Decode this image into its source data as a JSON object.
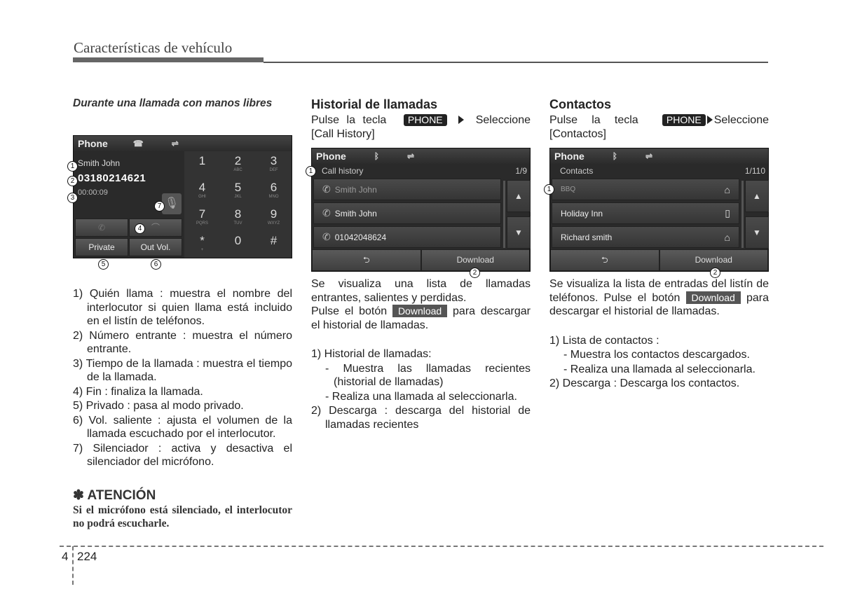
{
  "header": {
    "title": "Características de vehículo"
  },
  "col1": {
    "subtitle": "Durante una llamada con manos libres",
    "screen": {
      "app_title": "Phone",
      "status_icons": [
        "phone-handset-icon",
        "usb-icon"
      ],
      "caller_name": "Smith John",
      "caller_number": "03180214621",
      "call_time": "00:00:09",
      "buttons": {
        "answer": "",
        "end": "",
        "private": "Private",
        "out_vol": "Out Vol."
      },
      "keypad": [
        {
          "digit": "1",
          "letters": ""
        },
        {
          "digit": "2",
          "letters": "ABC"
        },
        {
          "digit": "3",
          "letters": "DEF"
        },
        {
          "digit": "4",
          "letters": "GHI"
        },
        {
          "digit": "5",
          "letters": "JKL"
        },
        {
          "digit": "6",
          "letters": "MNO"
        },
        {
          "digit": "7",
          "letters": "PQRS"
        },
        {
          "digit": "8",
          "letters": "TUV"
        },
        {
          "digit": "9",
          "letters": "WXYZ"
        },
        {
          "digit": "*",
          "letters": "+"
        },
        {
          "digit": "0",
          "letters": ""
        },
        {
          "digit": "#",
          "letters": ""
        }
      ],
      "callouts": [
        "1",
        "2",
        "3",
        "4",
        "5",
        "6",
        "7"
      ]
    },
    "items": [
      "1) Quién llama : muestra el nombre del interlocutor si quien llama está incluido en el listín de teléfonos.",
      "2) Número entrante : muestra el número entrante.",
      "3) Tiempo de la llamada : muestra el tiempo de la llamada.",
      "4) Fin : finaliza la llamada.",
      "5) Privado : pasa al modo privado.",
      "6) Vol. saliente : ajusta el volumen de la llamada escuchado por el interlocutor.",
      "7) Silenciador : activa y desactiva el silenciador del micrófono."
    ],
    "attention": {
      "title": "✽ ATENCIÓN",
      "body": "Si el micrófono está silenciado, el interlocutor no podrá escucharle."
    }
  },
  "col2": {
    "title": "Historial de llamadas",
    "intro_pre": "Pulse la tecla",
    "key_label": "PHONE",
    "intro_post": "Seleccione [Call History]",
    "screen": {
      "app_title": "Phone",
      "sub_title": "Call history",
      "page": "1/9",
      "rows": [
        "Smith John",
        "Smith John",
        "01042048624"
      ],
      "back_label": "⮌",
      "download_label": "Download"
    },
    "desc1": "Se visualiza una lista de llamadas entrantes, salientes y perdidas.",
    "desc2_pre": "Pulse el botón",
    "download_badge": "Download",
    "desc2_post": "para descargar el historial de llamadas.",
    "item1": "1) Historial de llamadas:",
    "sub1": [
      "- Muestra las llamadas recientes (historial de llamadas)",
      "- Realiza una llamada al seleccionarla."
    ],
    "item2": "2) Descarga : descarga del historial de llamadas recientes"
  },
  "col3": {
    "title": "Contactos",
    "intro_pre": "Pulse la tecla",
    "key_label": "PHONE",
    "intro_post": "Seleccione [Contactos]",
    "screen": {
      "app_title": "Phone",
      "sub_title": "Contacts",
      "page": "1/110",
      "rows": [
        {
          "name": "BBQ",
          "icon": "home-icon"
        },
        {
          "name": "Holiday Inn",
          "icon": "mobile-icon"
        },
        {
          "name": "Richard smith",
          "icon": "home-icon"
        }
      ],
      "download_label": "Download"
    },
    "desc_pre": "Se visualiza la lista de entradas del listín de teléfonos. Pulse el botón",
    "download_badge": "Download",
    "desc_post": "para descargar el historial de llamadas.",
    "item1": "1) Lista de contactos :",
    "sub1": [
      "- Muestra los contactos descargados.",
      "- Realiza una llamada al seleccionarla."
    ],
    "item2": "2) Descarga : Descarga los contactos."
  },
  "footer": {
    "chapter": "4",
    "page": "224"
  }
}
